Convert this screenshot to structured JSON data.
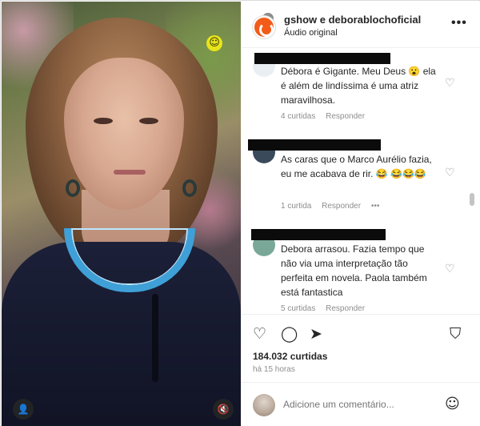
{
  "header": {
    "title": "gshow e deborablochoficial",
    "subtitle": "Áudio original",
    "more_label": "•••"
  },
  "media": {
    "overlay_emoji": "☺",
    "user_button_icon": "👤",
    "mute_button_icon": "🔇"
  },
  "comments": [
    {
      "text": "Débora é Gigante. Meu Deus 😮 ela é além de lindíssima é uma atriz maravilhosa.",
      "likes": "4 curtidas",
      "reply": "Responder",
      "more": ""
    },
    {
      "text": "As caras que o Marco Aurélio fazia, eu me acabava de rir. 😂 😂😂😂",
      "likes": "1 curtida",
      "reply": "Responder",
      "more": "•••"
    },
    {
      "text": "Debora arrasou. Fazia tempo que não via uma interpretação tão perfeita em novela. Paola também está fantastica",
      "likes": "5 curtidas",
      "reply": "Responder",
      "more": ""
    }
  ],
  "actions": {
    "like_icon": "♡",
    "comment_icon": "◯",
    "share_icon": "➤",
    "save_icon": "⛉"
  },
  "post": {
    "likes_count": "184.032 curtidas",
    "time_ago": "há 15 horas"
  },
  "add_comment": {
    "placeholder": "Adicione um comentário...",
    "emoji_icon": "☺"
  },
  "colors": {
    "brand_orange": "#f25c18",
    "necklace_blue": "#3fa0d8",
    "text": "#262626",
    "muted": "#8e8e8e"
  }
}
